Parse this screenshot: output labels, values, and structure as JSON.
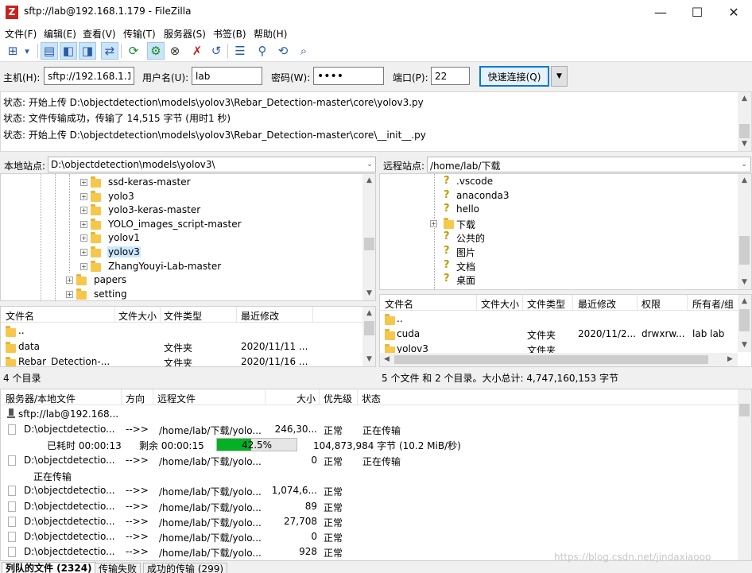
{
  "window": {
    "title": "sftp://lab@192.168.1.179 - FileZilla",
    "app_icon_letter": "Z",
    "min": "—",
    "max": "☐",
    "close": "✕"
  },
  "menu": [
    "文件(F)",
    "编辑(E)",
    "查看(V)",
    "传输(T)",
    "服务器(S)",
    "书签(B)",
    "帮助(H)"
  ],
  "toolbar": [
    {
      "name": "site-manager-icon",
      "glyph": "⊞",
      "on": false
    },
    {
      "name": "site-manager-dropdown-icon",
      "glyph": "▾",
      "on": false
    },
    {
      "name": "toggle-log-icon",
      "glyph": "▤",
      "on": true
    },
    {
      "name": "toggle-local-tree-icon",
      "glyph": "◧",
      "on": true
    },
    {
      "name": "toggle-remote-tree-icon",
      "glyph": "◨",
      "on": true
    },
    {
      "name": "toggle-queue-icon",
      "glyph": "⇄",
      "on": true
    },
    {
      "name": "refresh-icon",
      "glyph": "⟳",
      "on": false
    },
    {
      "name": "process-queue-icon",
      "glyph": "⚙",
      "on": true
    },
    {
      "name": "cancel-icon",
      "glyph": "⊗",
      "on": false
    },
    {
      "name": "disconnect-icon",
      "glyph": "✗",
      "on": false
    },
    {
      "name": "reconnect-icon",
      "glyph": "↺",
      "on": false
    },
    {
      "name": "filter-icon",
      "glyph": "☰",
      "on": false
    },
    {
      "name": "compare-icon",
      "glyph": "⚲",
      "on": false
    },
    {
      "name": "sync-browse-icon",
      "glyph": "⟲",
      "on": false
    },
    {
      "name": "search-icon",
      "glyph": "⌕",
      "on": false
    }
  ],
  "quickconnect": {
    "host_label": "主机(H):",
    "host_value": "sftp://192.168.1.179",
    "user_label": "用户名(U):",
    "user_value": "lab",
    "pass_label": "密码(W):",
    "pass_value": "••••",
    "port_label": "端口(P):",
    "port_value": "22",
    "connect_label": "快速连接(Q)",
    "dropdown": "▼"
  },
  "log": [
    "状态:  开始上传 D:\\objectdetection\\models\\yolov3\\Rebar_Detection-master\\core\\yolov3.py",
    "状态:  文件传输成功，传输了 14,515 字节 (用时1 秒)",
    "状态:  开始上传 D:\\objectdetection\\models\\yolov3\\Rebar_Detection-master\\core\\__init__.py"
  ],
  "local": {
    "site_label": "本地站点:",
    "path": "D:\\objectdetection\\models\\yolov3\\",
    "tree": [
      {
        "label": "ssd-keras-master",
        "exp": "+",
        "level": 2
      },
      {
        "label": "yolo3",
        "exp": "+",
        "level": 2
      },
      {
        "label": "yolo3-keras-master",
        "exp": "+",
        "level": 2
      },
      {
        "label": "YOLO_images_script-master",
        "exp": "+",
        "level": 2
      },
      {
        "label": "yolov1",
        "exp": "+",
        "level": 2
      },
      {
        "label": "yolov3",
        "exp": "+",
        "level": 2,
        "selected": true
      },
      {
        "label": "ZhangYouyi-Lab-master",
        "exp": "+",
        "level": 2
      },
      {
        "label": "papers",
        "exp": "+",
        "level": 1
      },
      {
        "label": "setting",
        "exp": "+",
        "level": 1
      }
    ],
    "columns": [
      "文件名",
      "文件大小",
      "文件类型",
      "最近修改"
    ],
    "rows": [
      {
        "name": "..",
        "size": "",
        "type": "",
        "modified": ""
      },
      {
        "name": "data",
        "size": "",
        "type": "文件夹",
        "modified": "2020/11/11 ..."
      },
      {
        "name": "Rebar_Detection-...",
        "size": "",
        "type": "文件夹",
        "modified": "2020/11/16 ..."
      }
    ],
    "status": "4 个目录"
  },
  "remote": {
    "site_label": "远程站点:",
    "path": "/home/lab/下载",
    "tree": [
      {
        "label": ".vscode",
        "exp": "",
        "icon": "?"
      },
      {
        "label": "anaconda3",
        "exp": "",
        "icon": "?"
      },
      {
        "label": "hello",
        "exp": "",
        "icon": "?"
      },
      {
        "label": "下载",
        "exp": "+",
        "icon": "folder"
      },
      {
        "label": "公共的",
        "exp": "",
        "icon": "?"
      },
      {
        "label": "图片",
        "exp": "",
        "icon": "?"
      },
      {
        "label": "文档",
        "exp": "",
        "icon": "?"
      },
      {
        "label": "桌面",
        "exp": "",
        "icon": "?"
      }
    ],
    "columns": [
      "文件名",
      "文件大小",
      "文件类型",
      "最近修改",
      "权限",
      "所有者/组"
    ],
    "rows": [
      {
        "name": "..",
        "size": "",
        "type": "",
        "modified": "",
        "perm": "",
        "owner": ""
      },
      {
        "name": "cuda",
        "size": "",
        "type": "文件夹",
        "modified": "2020/11/2...",
        "perm": "drwxrw...",
        "owner": "lab lab"
      },
      {
        "name": "yolov3",
        "size": "",
        "type": "文件夹",
        "modified": "",
        "perm": "",
        "owner": ""
      }
    ],
    "status": "5 个文件 和 2 个目录。大小总计: 4,747,160,153 字节"
  },
  "queue": {
    "columns": [
      "服务器/本地文件",
      "方向",
      "远程文件",
      "大小",
      "优先级",
      "状态"
    ],
    "server": "sftp://lab@192.168...",
    "rows": [
      {
        "local": "D:\\objectdetectio...",
        "dir": "-->>",
        "remote": "/home/lab/下载/yolo...",
        "size": "246,30...",
        "prio": "正常",
        "status": "正在传输"
      },
      {
        "progress": true,
        "elapsed": "已耗时 00:00:13",
        "remaining": "剩余 00:00:15",
        "percent": 42.5,
        "percent_label": "42.5%",
        "bytes": "104,873,984 字节 (10.2 MiB/秒)"
      },
      {
        "local": "D:\\objectdetectio...",
        "dir": "-->>",
        "remote": "/home/lab/下载/yolo...",
        "size": "0",
        "prio": "正常",
        "status": "正在传输"
      },
      {
        "substatus": "正在传输"
      },
      {
        "local": "D:\\objectdetectio...",
        "dir": "-->>",
        "remote": "/home/lab/下载/yolo...",
        "size": "1,074,6...",
        "prio": "正常",
        "status": ""
      },
      {
        "local": "D:\\objectdetectio...",
        "dir": "-->>",
        "remote": "/home/lab/下载/yolo...",
        "size": "89",
        "prio": "正常",
        "status": ""
      },
      {
        "local": "D:\\objectdetectio...",
        "dir": "-->>",
        "remote": "/home/lab/下载/yolo...",
        "size": "27,708",
        "prio": "正常",
        "status": ""
      },
      {
        "local": "D:\\objectdetectio...",
        "dir": "-->>",
        "remote": "/home/lab/下载/yolo...",
        "size": "0",
        "prio": "正常",
        "status": ""
      },
      {
        "local": "D:\\objectdetectio...",
        "dir": "-->>",
        "remote": "/home/lab/下载/yolo...",
        "size": "928",
        "prio": "正常",
        "status": ""
      }
    ],
    "tabs": [
      "列队的文件 (2324)",
      "传输失败",
      "成功的传输 (299)"
    ]
  },
  "watermark": "https://blog.csdn.net/jindaxiaooo",
  "colors": {
    "progress": "#06b025",
    "selected": "#cce8ff"
  }
}
